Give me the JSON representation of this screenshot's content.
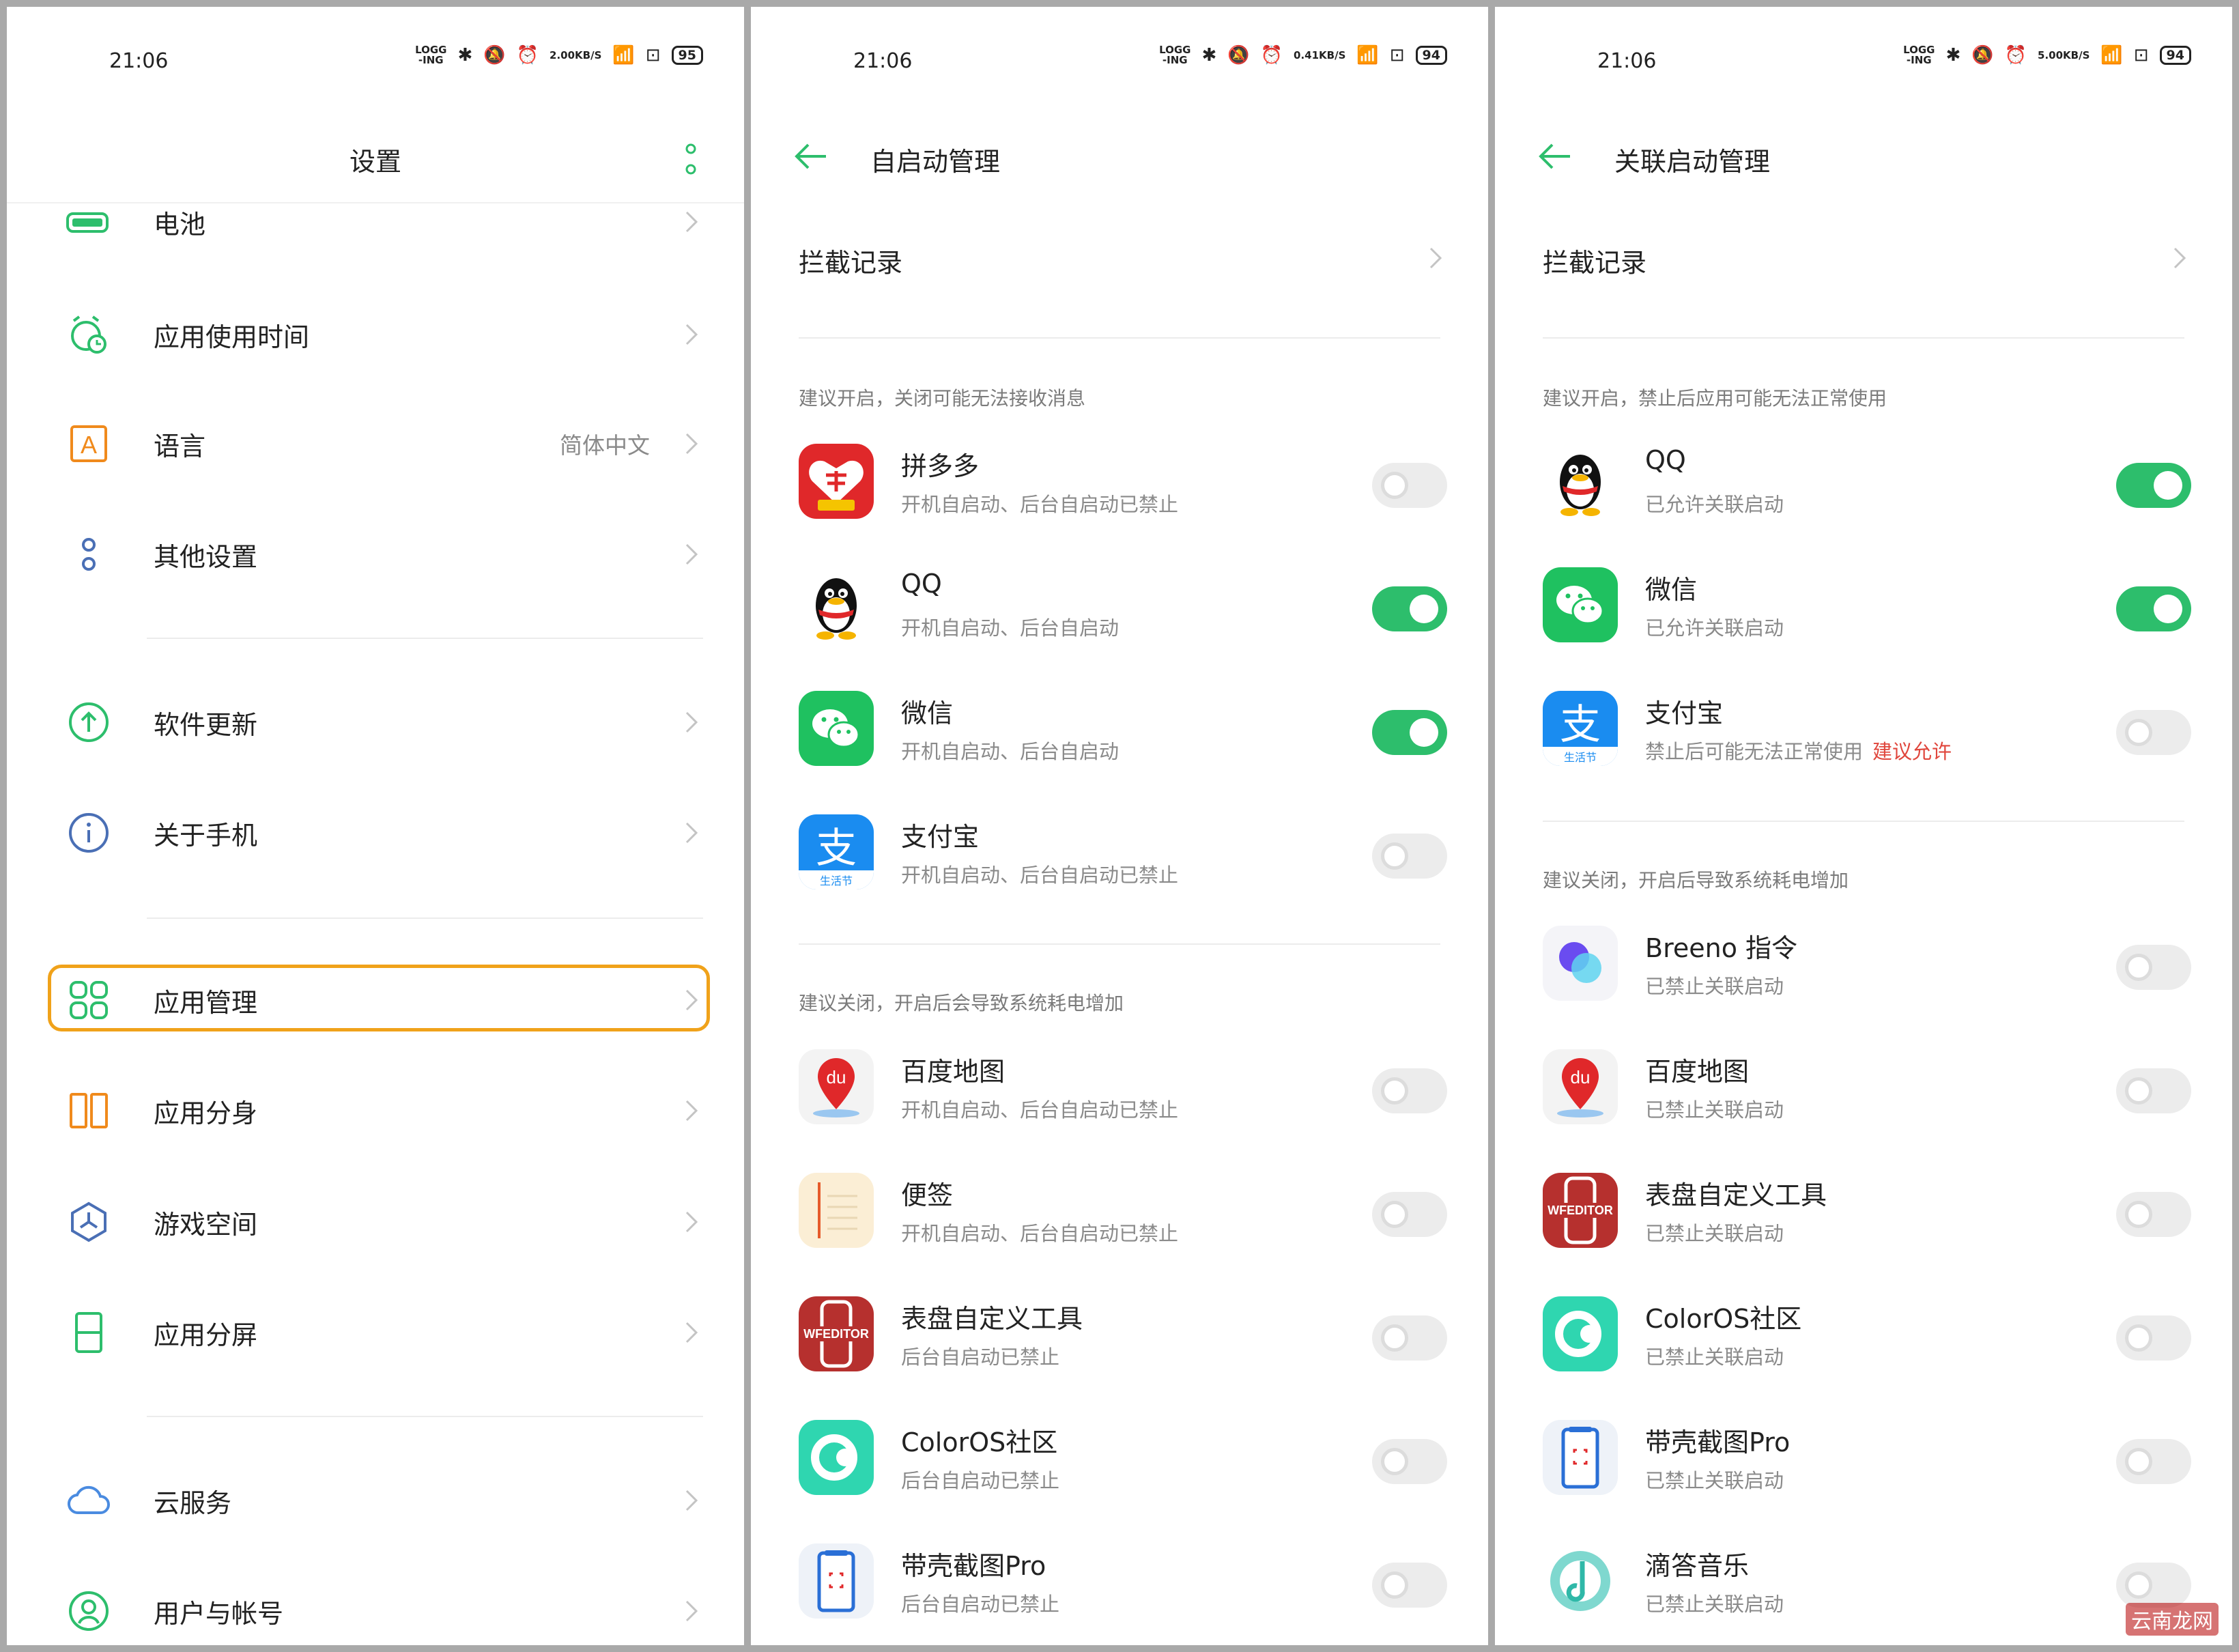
{
  "panels": [
    {
      "status": {
        "time": "21:06",
        "net_speed": "2.00",
        "net_unit": "KB/S",
        "battery": "95"
      },
      "header": {
        "title": "设置"
      },
      "items": [
        {
          "label": "电池"
        },
        {
          "label": "应用使用时间"
        },
        {
          "label": "语言",
          "value": "简体中文"
        },
        {
          "label": "其他设置"
        },
        {
          "label": "软件更新"
        },
        {
          "label": "关于手机"
        },
        {
          "label": "应用管理"
        },
        {
          "label": "应用分身"
        },
        {
          "label": "游戏空间"
        },
        {
          "label": "应用分屏"
        },
        {
          "label": "云服务"
        },
        {
          "label": "用户与帐号"
        }
      ]
    },
    {
      "status": {
        "time": "21:06",
        "net_speed": "0.41",
        "net_unit": "KB/S",
        "battery": "94"
      },
      "header": {
        "title": "自启动管理"
      },
      "entry": "拦截记录",
      "section1": "建议开启，关闭可能无法接收消息",
      "section2": "建议关闭，开启后会导致系统耗电增加",
      "apps": [
        {
          "name": "拼多多",
          "sub": "开机自启动、后台自启动已禁止",
          "on": false
        },
        {
          "name": "QQ",
          "sub": "开机自启动、后台自启动",
          "on": true
        },
        {
          "name": "微信",
          "sub": "开机自启动、后台自启动",
          "on": true
        },
        {
          "name": "支付宝",
          "sub": "开机自启动、后台自启动已禁止",
          "on": false
        },
        {
          "name": "百度地图",
          "sub": "开机自启动、后台自启动已禁止",
          "on": false
        },
        {
          "name": "便签",
          "sub": "开机自启动、后台自启动已禁止",
          "on": false
        },
        {
          "name": "表盘自定义工具",
          "sub": "后台自启动已禁止",
          "on": false
        },
        {
          "name": "ColorOS社区",
          "sub": "后台自启动已禁止",
          "on": false
        },
        {
          "name": "带壳截图Pro",
          "sub": "后台自启动已禁止",
          "on": false
        }
      ]
    },
    {
      "status": {
        "time": "21:06",
        "net_speed": "5.00",
        "net_unit": "KB/S",
        "battery": "94"
      },
      "header": {
        "title": "关联启动管理"
      },
      "entry": "拦截记录",
      "section1": "建议开启，禁止后应用可能无法正常使用",
      "section2": "建议关闭，开启后导致系统耗电增加",
      "apps": [
        {
          "name": "QQ",
          "sub": "已允许关联启动",
          "on": true
        },
        {
          "name": "微信",
          "sub": "已允许关联启动",
          "on": true
        },
        {
          "name": "支付宝",
          "sub": "禁止后可能无法正常使用",
          "warn": "建议允许",
          "on": false
        },
        {
          "name": "Breeno 指令",
          "sub": "已禁止关联启动",
          "on": false
        },
        {
          "name": "百度地图",
          "sub": "已禁止关联启动",
          "on": false
        },
        {
          "name": "表盘自定义工具",
          "sub": "已禁止关联启动",
          "on": false
        },
        {
          "name": "ColorOS社区",
          "sub": "已禁止关联启动",
          "on": false
        },
        {
          "name": "带壳截图Pro",
          "sub": "已禁止关联启动",
          "on": false
        },
        {
          "name": "滴答音乐",
          "sub": "已禁止关联启动",
          "on": false
        }
      ]
    }
  ],
  "watermark": "云南龙网",
  "colors": {
    "accent": "#2dbe6c",
    "highlight": "#f0a21a",
    "warn": "#e0463c"
  }
}
